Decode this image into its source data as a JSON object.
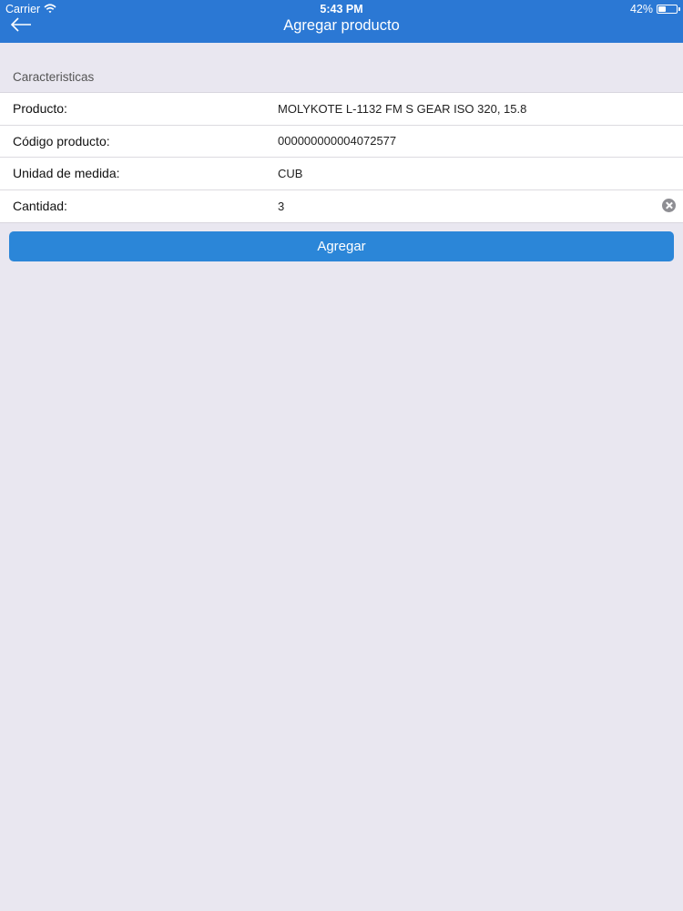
{
  "status_bar": {
    "carrier": "Carrier",
    "time": "5:43 PM",
    "battery_text": "42%",
    "battery_level": 0.42
  },
  "nav": {
    "title": "Agregar producto",
    "back_icon": "arrow-left-icon"
  },
  "section": {
    "header": "Caracteristicas"
  },
  "fields": [
    {
      "label": "Producto:",
      "value": "MOLYKOTE L-1132 FM S GEAR ISO 320, 15.8"
    },
    {
      "label": "Código producto:",
      "value": "000000000004072577"
    },
    {
      "label": "Unidad de medida:",
      "value": "CUB"
    },
    {
      "label": "Cantidad:",
      "value": "3"
    }
  ],
  "actions": {
    "add_label": "Agregar"
  },
  "colors": {
    "nav_background": "#2b78d4",
    "button_background": "#2b86d8",
    "page_background": "#e9e7f0"
  }
}
